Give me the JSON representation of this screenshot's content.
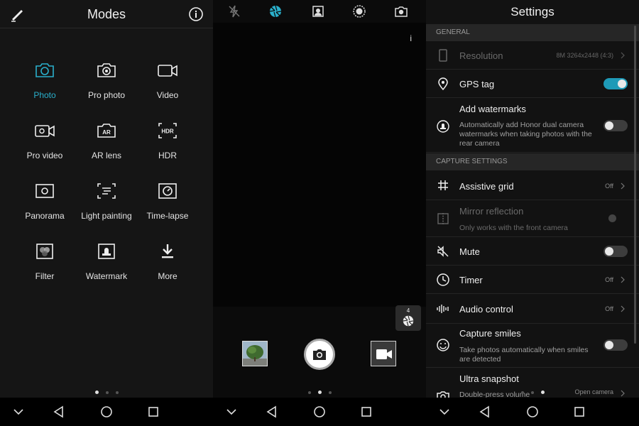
{
  "modes": {
    "title": "Modes",
    "items": [
      {
        "label": "Photo",
        "icon": "camera-icon",
        "active": true
      },
      {
        "label": "Pro photo",
        "icon": "pro-camera-icon"
      },
      {
        "label": "Video",
        "icon": "video-icon"
      },
      {
        "label": "Pro video",
        "icon": "pro-video-icon"
      },
      {
        "label": "AR lens",
        "icon": "ar-lens-icon"
      },
      {
        "label": "HDR",
        "icon": "hdr-icon"
      },
      {
        "label": "Panorama",
        "icon": "panorama-icon"
      },
      {
        "label": "Light painting",
        "icon": "light-painting-icon"
      },
      {
        "label": "Time-lapse",
        "icon": "time-lapse-icon"
      },
      {
        "label": "Filter",
        "icon": "filter-icon"
      },
      {
        "label": "Watermark",
        "icon": "watermark-icon"
      },
      {
        "label": "More",
        "icon": "download-icon"
      }
    ],
    "hdr_icon_text": "HDR",
    "ar_icon_text": "AR"
  },
  "camera": {
    "info_label": "i",
    "burst_count": "4"
  },
  "settings": {
    "title": "Settings",
    "sections": {
      "general": "GENERAL",
      "capture": "CAPTURE SETTINGS"
    },
    "resolution": {
      "label": "Resolution",
      "value": "8M 3264x2448 (4:3)"
    },
    "gps": {
      "label": "GPS tag",
      "on": true
    },
    "watermarks": {
      "label": "Add watermarks",
      "sub": "Automatically add Honor dual camera watermarks when taking photos with the rear camera",
      "on": false
    },
    "grid": {
      "label": "Assistive grid",
      "value": "Off"
    },
    "mirror": {
      "label": "Mirror reflection",
      "sub": "Only works with the front camera"
    },
    "mute": {
      "label": "Mute",
      "on": false
    },
    "timer": {
      "label": "Timer",
      "value": "Off"
    },
    "audio": {
      "label": "Audio control",
      "value": "Off"
    },
    "smiles": {
      "label": "Capture smiles",
      "sub": "Take photos automatically when smiles are detected",
      "on": false
    },
    "ultra": {
      "label": "Ultra snapshot",
      "sub": "Double-press volume",
      "value": "Open camera"
    }
  },
  "colors": {
    "accent": "#2ab0cc",
    "toggle_on": "#1e9ab7"
  }
}
